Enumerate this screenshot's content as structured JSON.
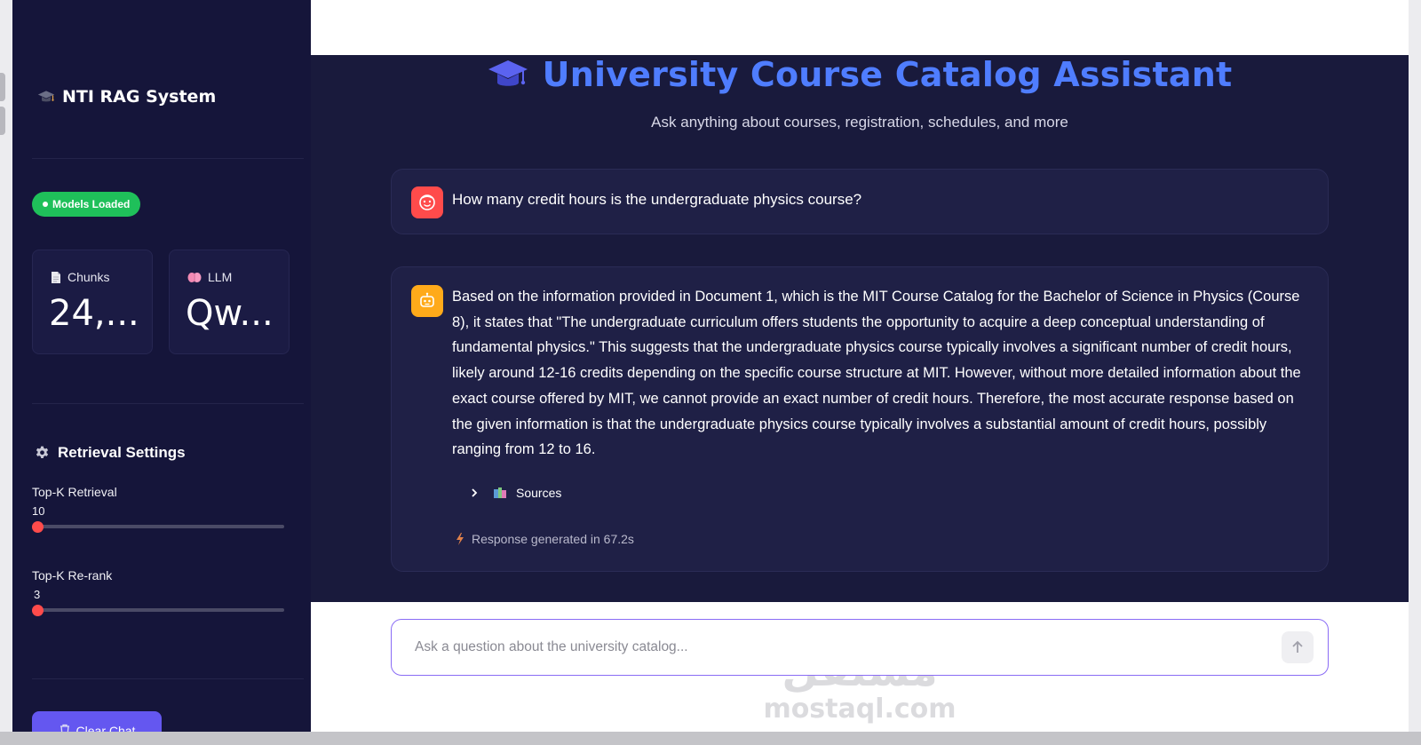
{
  "sidebar": {
    "brand": "NTI RAG System",
    "status": "Models Loaded",
    "metrics": [
      {
        "label": "Chunks",
        "value": "24,...",
        "icon": "document-icon"
      },
      {
        "label": "LLM",
        "value": "Qw...",
        "icon": "brain-icon"
      }
    ],
    "settings_title": "Retrieval Settings",
    "sliders": [
      {
        "label": "Top-K Retrieval",
        "value": "10"
      },
      {
        "label": "Top-K Re-rank",
        "value": "3"
      }
    ],
    "clear_button": "Clear Chat"
  },
  "main": {
    "title": "University Course Catalog Assistant",
    "subtitle": "Ask anything about courses, registration, schedules, and more",
    "user_message": "How many credit hours is the undergraduate physics course?",
    "assistant_message": "Based on the information provided in Document 1, which is the MIT Course Catalog for the Bachelor of Science in Physics (Course 8), it states that \"The undergraduate curriculum offers students the opportunity to acquire a deep conceptual understanding of fundamental physics.\" This suggests that the undergraduate physics course typically involves a significant number of credit hours, likely around 12-16 credits depending on the specific course structure at MIT. However, without more detailed information about the exact course offered by MIT, we cannot provide an exact number of credit hours. Therefore, the most accurate response based on the given information is that the undergraduate physics course typically involves a substantial amount of credit hours, possibly ranging from 12 to 16.",
    "sources_label": "Sources",
    "response_time": "Response generated in 67.2s",
    "input_placeholder": "Ask a question about the university catalog..."
  },
  "watermark": {
    "arabic": "مستقل",
    "latin": "mostaql.com"
  },
  "colors": {
    "sidebar_bg": "#15153a",
    "main_bg": "#191a3c",
    "title": "#4f7dff",
    "status_green": "#1fc05a",
    "slider_thumb": "#ff4b4b",
    "clear_button": "#6457f0",
    "input_border": "#8a6cf5"
  }
}
